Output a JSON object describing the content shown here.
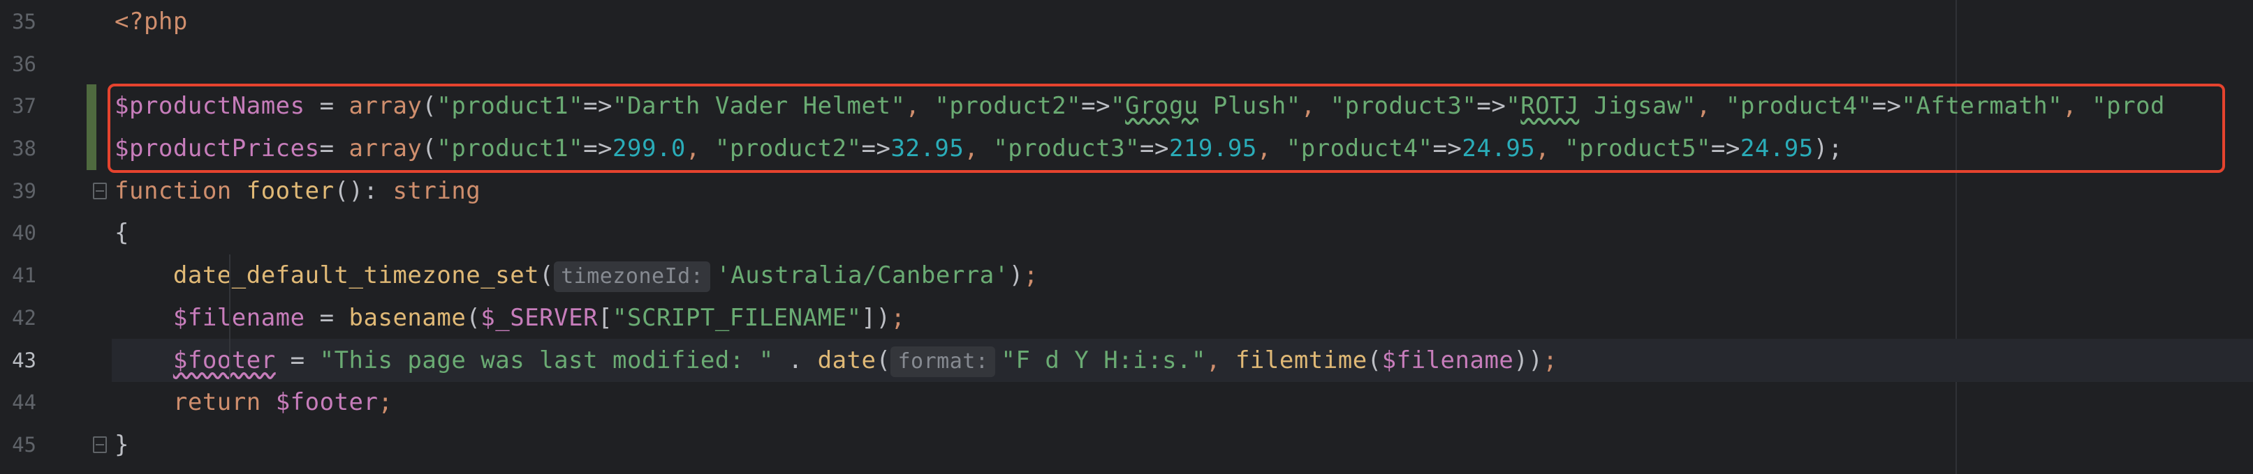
{
  "line_numbers": [
    "35",
    "36",
    "37",
    "38",
    "39",
    "40",
    "41",
    "42",
    "43",
    "44",
    "45"
  ],
  "code": {
    "l35": {
      "open_tag": "<?php"
    },
    "l37": {
      "var": "$productNames",
      "op": " = ",
      "call": "array",
      "p_open": "(",
      "k1": "\"product1\"",
      "a1": "=>",
      "v1": "\"Darth Vader Helmet\"",
      "s1": ", ",
      "k2": "\"product2\"",
      "a2": "=>",
      "v2a": "\"",
      "v2b": "Grogu",
      "v2c": " Plush\"",
      "s2": ", ",
      "k3": "\"product3\"",
      "a3": "=>",
      "v3a": "\"",
      "v3b": "ROTJ",
      "v3c": " Jigsaw\"",
      "s3": ", ",
      "k4": "\"product4\"",
      "a4": "=>",
      "v4": "\"Aftermath\"",
      "s4": ", ",
      "k5": "\"prod"
    },
    "l38": {
      "var": "$productPrices",
      "op": "= ",
      "call": "array",
      "p_open": "(",
      "k1": "\"product1\"",
      "a1": "=>",
      "v1": "299.0",
      "s1": ", ",
      "k2": "\"product2\"",
      "a2": "=>",
      "v2": "32.95",
      "s2": ", ",
      "k3": "\"product3\"",
      "a3": "=>",
      "v3": "219.95",
      "s3": ", ",
      "k4": "\"product4\"",
      "a4": "=>",
      "v4": "24.95",
      "s4": ", ",
      "k5": "\"product5\"",
      "a5": "=>",
      "v5": "24.95",
      "p_close": ");"
    },
    "l39": {
      "kw": "function",
      "name": " footer",
      "sig": "(): ",
      "type": "string"
    },
    "l40": {
      "brace": "{"
    },
    "l41": {
      "indent": "    ",
      "fn": "date_default_timezone_set",
      "p_open": "(",
      "hint": "timezoneId:",
      "arg": "'Australia/Canberra'",
      "p_close": ")",
      "semi": ";"
    },
    "l42": {
      "indent": "    ",
      "var": "$filename",
      "op": " = ",
      "fn": "basename",
      "p_open": "(",
      "arg_var": "$_SERVER",
      "br_open": "[",
      "arg_str": "\"SCRIPT_FILENAME\"",
      "br_close": "]",
      "p_close": ")",
      "semi": ";"
    },
    "l43": {
      "indent": "    ",
      "var": "$footer",
      "op": " = ",
      "str": "\"This page was last modified: \"",
      "concat": " . ",
      "fn": "date",
      "p_open": "(",
      "hint": "format:",
      "arg": "\"F d Y H:i:s.\"",
      "sep": ", ",
      "fn2": "filemtime",
      "p2_open": "(",
      "arg2": "$filename",
      "p_close": "))",
      "semi": ";"
    },
    "l44": {
      "indent": "    ",
      "kw": "return",
      "sp": " ",
      "var": "$footer",
      "semi": ";"
    },
    "l45": {
      "brace": "}"
    }
  },
  "colors": {
    "background": "#1f2023",
    "keyword": "#cf8e6d",
    "variable": "#c77dbb",
    "string": "#6aab73",
    "number": "#2aacb8",
    "function": "#e0b976",
    "highlight_box": "#e5432e"
  },
  "icons": {
    "bulb": "lightbulb-icon",
    "fold": "fold-marker-icon"
  }
}
